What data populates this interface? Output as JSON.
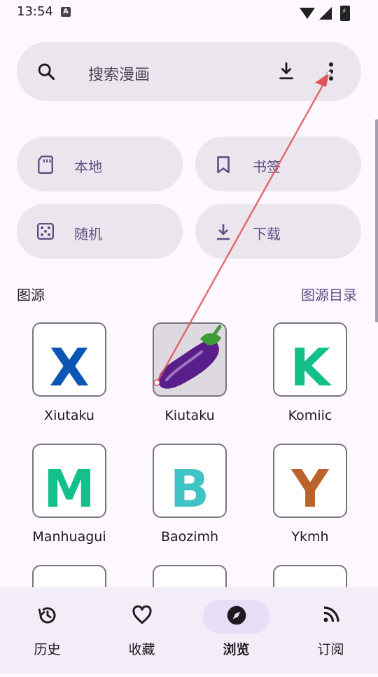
{
  "status_bar": {
    "time": "13:54",
    "notification_icon": "A"
  },
  "search": {
    "placeholder": "搜索漫画"
  },
  "quick_actions": [
    {
      "label": "本地",
      "icon": "sd-card-icon"
    },
    {
      "label": "书签",
      "icon": "bookmark-icon"
    },
    {
      "label": "随机",
      "icon": "dice-icon"
    },
    {
      "label": "下载",
      "icon": "download-icon"
    }
  ],
  "sources_section": {
    "title": "图源",
    "link": "图源目录"
  },
  "sources": [
    {
      "name": "Xiutaku",
      "letter": "X",
      "color": "#0b56b3"
    },
    {
      "name": "Kiutaku",
      "letter": "",
      "color": "#5a1e8a"
    },
    {
      "name": "Komiic",
      "letter": "K",
      "color": "#14c08a"
    },
    {
      "name": "Manhuagui",
      "letter": "M",
      "color": "#14c08a"
    },
    {
      "name": "Baozimh",
      "letter": "B",
      "color": "#3fc3c4"
    },
    {
      "name": "Ykmh",
      "letter": "Y",
      "color": "#b8642a"
    }
  ],
  "bottom_nav": [
    {
      "label": "历史",
      "icon": "history-icon",
      "active": false
    },
    {
      "label": "收藏",
      "icon": "heart-icon",
      "active": false
    },
    {
      "label": "浏览",
      "icon": "compass-icon",
      "active": true
    },
    {
      "label": "订阅",
      "icon": "rss-icon",
      "active": false
    }
  ],
  "colors": {
    "accent": "#5b4f84",
    "surface": "#ebe6ee",
    "annotation_arrow": "#e05555"
  }
}
